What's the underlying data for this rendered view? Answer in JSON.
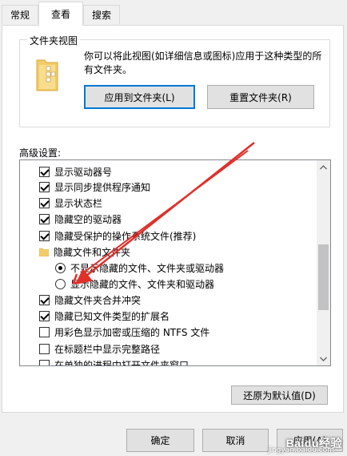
{
  "tabs": [
    {
      "label": "常规"
    },
    {
      "label": "查看"
    },
    {
      "label": "搜索"
    }
  ],
  "folder_views": {
    "title": "文件夹视图",
    "description": "你可以将此视图(如详细信息或图标)应用于这种类型的所有文件夹。",
    "apply_button": "应用到文件夹(L)",
    "reset_button": "重置文件夹(R)"
  },
  "advanced": {
    "label": "高级设置:",
    "items": [
      {
        "type": "checkbox",
        "checked": true,
        "label": "显示驱动器号"
      },
      {
        "type": "checkbox",
        "checked": true,
        "label": "显示同步提供程序通知"
      },
      {
        "type": "checkbox",
        "checked": true,
        "label": "显示状态栏"
      },
      {
        "type": "checkbox",
        "checked": true,
        "label": "隐藏空的驱动器"
      },
      {
        "type": "checkbox",
        "checked": true,
        "label": "隐藏受保护的操作系统文件(推荐)"
      },
      {
        "type": "folder",
        "label": "隐藏文件和文件夹"
      },
      {
        "type": "radio",
        "checked": true,
        "label": "不显示隐藏的文件、文件夹或驱动器"
      },
      {
        "type": "radio",
        "checked": false,
        "label": "显示隐藏的文件、文件夹和驱动器"
      },
      {
        "type": "checkbox",
        "checked": true,
        "label": "隐藏文件夹合并冲突"
      },
      {
        "type": "checkbox",
        "checked": true,
        "label": "隐藏已知文件类型的扩展名"
      },
      {
        "type": "checkbox",
        "checked": false,
        "label": "用彩色显示加密或压缩的 NTFS 文件"
      },
      {
        "type": "checkbox",
        "checked": false,
        "label": "在标题栏中显示完整路径"
      },
      {
        "type": "checkbox",
        "checked": false,
        "label": "在单独的进程中打开文件夹窗口"
      }
    ]
  },
  "restore_button": "还原为默认值(D)",
  "footer": {
    "ok": "确定",
    "cancel": "取消",
    "apply": "应用(A)"
  },
  "watermark": {
    "text": "Baidu经验",
    "sub": "jingyan.baidu.com"
  },
  "colors": {
    "annotation_arrow": "#e0302a",
    "focus": "#0078d7"
  }
}
